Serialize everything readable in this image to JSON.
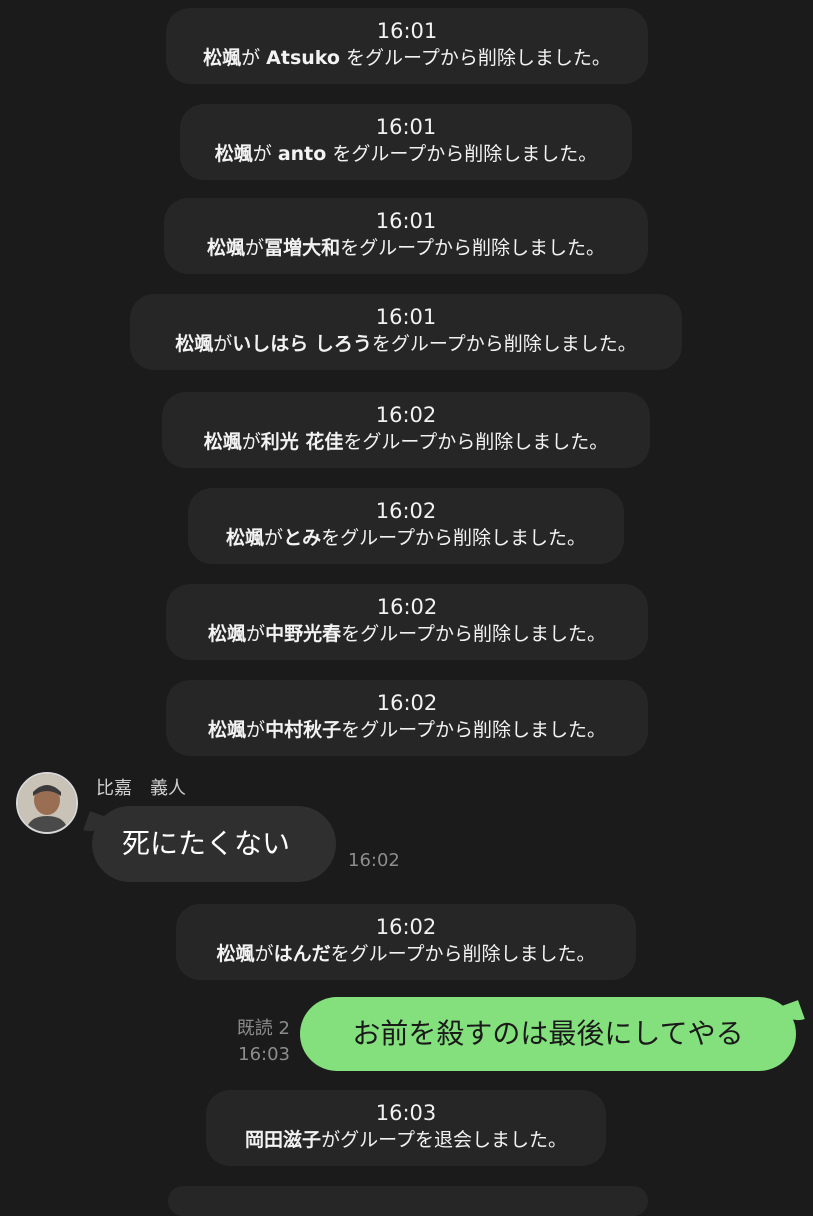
{
  "system_messages": [
    {
      "time": "16:01",
      "actor": "松颯",
      "connector1": "が",
      "target": "Atsuko",
      "suffix": "をグループから削除しました。"
    },
    {
      "time": "16:01",
      "actor": "松颯",
      "connector1": "が",
      "target": "anto",
      "suffix": "をグループから削除しました。"
    },
    {
      "time": "16:01",
      "actor": "松颯",
      "connector1": "が",
      "target": "冨増大和",
      "suffix": "をグループから削除しました。"
    },
    {
      "time": "16:01",
      "actor": "松颯",
      "connector1": "が",
      "target": "いしはら しろう",
      "suffix": "をグループから削除しました。"
    },
    {
      "time": "16:02",
      "actor": "松颯",
      "connector1": "が",
      "target": "利光 花佳",
      "suffix": "をグループから削除しました。"
    },
    {
      "time": "16:02",
      "actor": "松颯",
      "connector1": "が",
      "target": "とみ",
      "suffix": "をグループから削除しました。"
    },
    {
      "time": "16:02",
      "actor": "松颯",
      "connector1": "が",
      "target": "中野光春",
      "suffix": "をグループから削除しました。"
    },
    {
      "time": "16:02",
      "actor": "松颯",
      "connector1": "が",
      "target": "中村秋子",
      "suffix": "をグループから削除しました。"
    },
    {
      "time": "16:02",
      "actor": "松颯",
      "connector1": "が",
      "target": "はんだ",
      "suffix": "をグループから削除しました。"
    },
    {
      "time": "16:03",
      "actor": "岡田滋子",
      "connector1": "が",
      "target": "",
      "suffix": "グループを退会しました。"
    }
  ],
  "incoming": {
    "sender": "比嘉　義人",
    "text": "死にたくない",
    "time": "16:02",
    "avatar_icon": "user-avatar-icon"
  },
  "outgoing": {
    "read": "既読 2",
    "time": "16:03",
    "text": "お前を殺すのは最後にしてやる"
  },
  "colors": {
    "background": "#1b1b1b",
    "system_bubble": "#262626",
    "incoming_bubble": "#2f2f2f",
    "outgoing_bubble": "#84e07d"
  }
}
